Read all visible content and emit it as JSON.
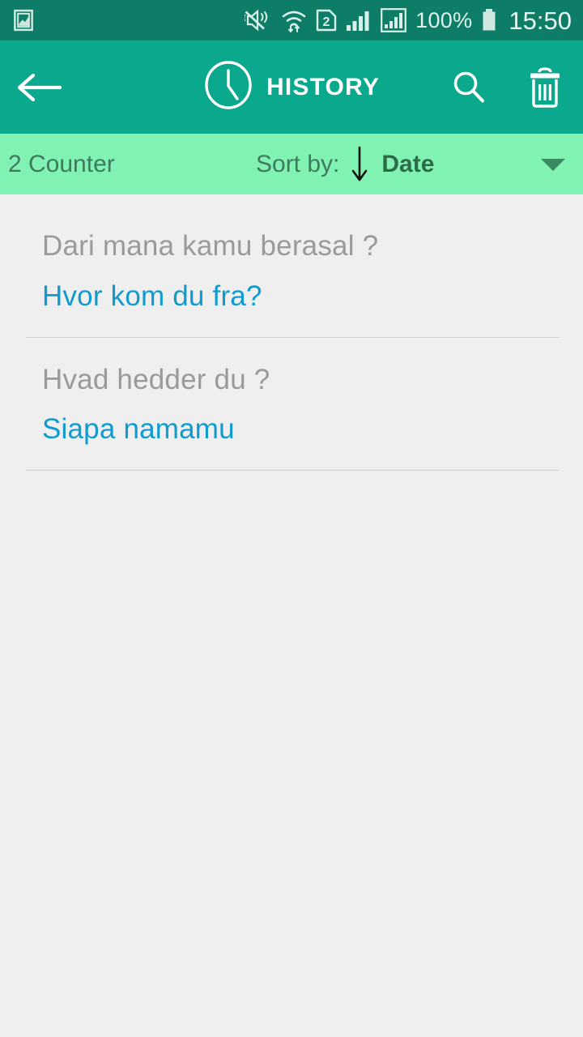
{
  "status_bar": {
    "icons": [
      {
        "name": "screenshot-icon",
        "glyph": "image-frame"
      },
      {
        "name": "sound-mute-vibrate-icon",
        "glyph": "speaker-muted"
      },
      {
        "name": "wifi-icon",
        "glyph": "wifi-transfer"
      },
      {
        "name": "sim-2-icon",
        "glyph": "2"
      },
      {
        "name": "signal-bars-icon",
        "glyph": "bars"
      },
      {
        "name": "mobile-data-icon",
        "glyph": "boxed-bars"
      }
    ],
    "battery_percent": "100%",
    "time": "15:50"
  },
  "app_bar": {
    "back_label": "Back",
    "title": "HISTORY",
    "clock_icon": "clock-icon",
    "search_icon": "search-icon",
    "delete_icon": "trash-icon"
  },
  "sort_bar": {
    "counter": "2 Counter",
    "sort_label": "Sort by:",
    "sort_direction": "descending",
    "sort_value": "Date",
    "dropdown_icon": "chevron-down-icon"
  },
  "history": {
    "items": [
      {
        "source": "Dari mana kamu berasal ?",
        "target": "Hvor kom du fra?"
      },
      {
        "source": "Hvad hedder du ?",
        "target": "Siapa namamu"
      }
    ]
  },
  "colors": {
    "status_bar_bg": "#0d7d68",
    "app_bar_bg": "#0aa88d",
    "sort_bar_bg": "#80f2b4",
    "page_bg": "#efefef",
    "source_text": "#9a9a9a",
    "target_text": "#0f9bd0",
    "counter_text": "#3f7a5c",
    "sort_value_text": "#2d6b48"
  }
}
